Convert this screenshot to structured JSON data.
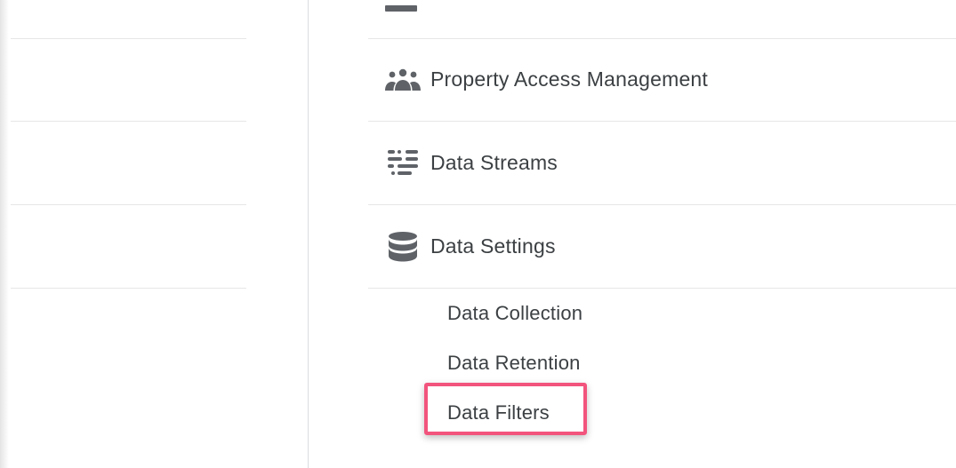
{
  "menu": {
    "items": [
      {
        "label": "Property Access Management",
        "icon": "people-icon"
      },
      {
        "label": "Data Streams",
        "icon": "data-streams-icon"
      },
      {
        "label": "Data Settings",
        "icon": "database-icon"
      }
    ],
    "data_settings_subitems": [
      {
        "label": "Data Collection"
      },
      {
        "label": "Data Retention"
      },
      {
        "label": "Data Filters"
      }
    ]
  },
  "colors": {
    "highlight": "#f2547d",
    "icon": "#5f6368",
    "text": "#3c4043",
    "divider": "#e6e6e6"
  }
}
